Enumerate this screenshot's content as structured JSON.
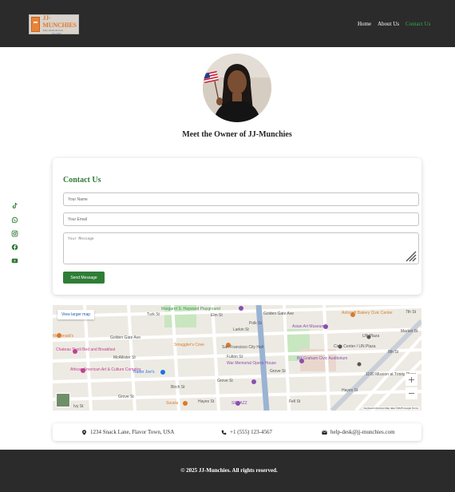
{
  "brand": {
    "logo_title": "JJ-MUNCHIES",
    "logo_tagline": "Tasty snacks & treats",
    "logo_sub": "Est. 2025",
    "accent_color": "#2f7d35"
  },
  "nav": {
    "items": [
      {
        "label": "Home",
        "active": false
      },
      {
        "label": "About Us",
        "active": false
      },
      {
        "label": "Contact Us",
        "active": true
      }
    ]
  },
  "owner": {
    "title": "Meet the Owner of JJ-Munchies"
  },
  "social": {
    "icons": [
      "tiktok-icon",
      "whatsapp-icon",
      "instagram-icon",
      "facebook-icon",
      "youtube-icon"
    ]
  },
  "contact": {
    "title": "Contact Us",
    "name_placeholder": "Your Name",
    "email_placeholder": "Your Email",
    "message_placeholder": "Your Message",
    "send_label": "Send Message"
  },
  "map": {
    "larger_map_link": "View larger map",
    "street_labels": [
      "Turk St",
      "Golden Gate Ave",
      "Golden Gate Ave",
      "Elm St",
      "McAllister St",
      "Fulton St",
      "Grove St",
      "Grove St",
      "Grove St",
      "Hayes St",
      "Ivy St",
      "Birch St",
      "Fell St",
      "Polk St",
      "Larkin St",
      "Hayes St",
      "Market St",
      "7th St",
      "8th St"
    ],
    "places": [
      {
        "name": "Margaret S. Hayward Playground",
        "color": "#3f8f4f"
      },
      {
        "name": "Asian Art Museum",
        "color": "#8a4fb0"
      },
      {
        "name": "Ashcroft Bakery Civic Center",
        "color": "#d97a2b"
      },
      {
        "name": "McDonald's",
        "color": "#d97a2b"
      },
      {
        "name": "Chateau Tivoli Bed and Breakfast",
        "color": "#c2408f"
      },
      {
        "name": "Smuggler's Cove",
        "color": "#d97a2b"
      },
      {
        "name": "San Francisco City Hall",
        "color": "#555555"
      },
      {
        "name": "Civic Center / UN Plaza",
        "color": "#555555"
      },
      {
        "name": "UN Plaza",
        "color": "#555555"
      },
      {
        "name": "African American Art & Culture Complex",
        "color": "#c2408f"
      },
      {
        "name": "Trader Joe's",
        "color": "#1a73e8"
      },
      {
        "name": "War Memorial Opera House",
        "color": "#8a4fb0"
      },
      {
        "name": "Bill Graham Civic Auditorium",
        "color": "#8a4fb0"
      },
      {
        "name": "1190 Mission at Trinity Place",
        "color": "#555555"
      },
      {
        "name": "Souvla",
        "color": "#d97a2b"
      },
      {
        "name": "SF JAZZ",
        "color": "#8a4fb0"
      }
    ],
    "zoom_in": "+",
    "zoom_out": "−",
    "attribution": "Keyboard shortcuts   Map data ©2025 Google   Terms"
  },
  "info": {
    "address": "1234 Snack Lane, Flavor Town, USA",
    "phone": "+1 (555) 123-4567",
    "email": "help-desk@jj-munchies.com"
  },
  "footer": {
    "copyright": "© 2025 JJ-Munchies. All rights reserved."
  }
}
